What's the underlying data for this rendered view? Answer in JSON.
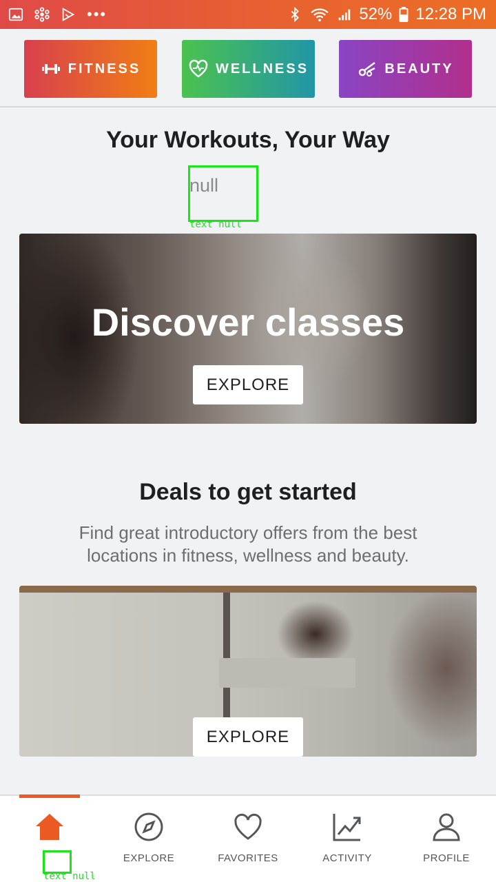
{
  "status_bar": {
    "battery": "52%",
    "time": "12:28 PM",
    "icons": [
      "gallery-icon",
      "settings-flower-icon",
      "play-store-icon",
      "more-dots-icon",
      "bluetooth-icon",
      "wifi-icon",
      "signal-icon",
      "battery-icon"
    ],
    "more": "•••"
  },
  "categories": [
    {
      "label": "FITNESS",
      "icon": "dumbbell-icon"
    },
    {
      "label": "WELLNESS",
      "icon": "heart-pulse-icon"
    },
    {
      "label": "BEAUTY",
      "icon": "scissors-icon"
    }
  ],
  "main": {
    "title": "Your Workouts, Your Way",
    "subtitle": "null",
    "annotation_label": "text null",
    "promo_card": {
      "title": "Discover classes",
      "button": "EXPLORE"
    },
    "deals": {
      "title": "Deals to get started",
      "description": "Find great introductory offers from the best locations in fitness, wellness and beauty.",
      "button": "EXPLORE"
    }
  },
  "bottom_nav": {
    "items": [
      {
        "label": "",
        "icon": "home-icon",
        "active": true
      },
      {
        "label": "EXPLORE",
        "icon": "compass-icon"
      },
      {
        "label": "FAVORITES",
        "icon": "heart-icon"
      },
      {
        "label": "ACTIVITY",
        "icon": "activity-chart-icon"
      },
      {
        "label": "PROFILE",
        "icon": "profile-icon"
      }
    ],
    "annotation_label": "text null"
  },
  "colors": {
    "accent": "#ec5a24",
    "fitness": "#f07e14",
    "wellness": "#4cc24f",
    "beauty": "#8a44c4"
  }
}
